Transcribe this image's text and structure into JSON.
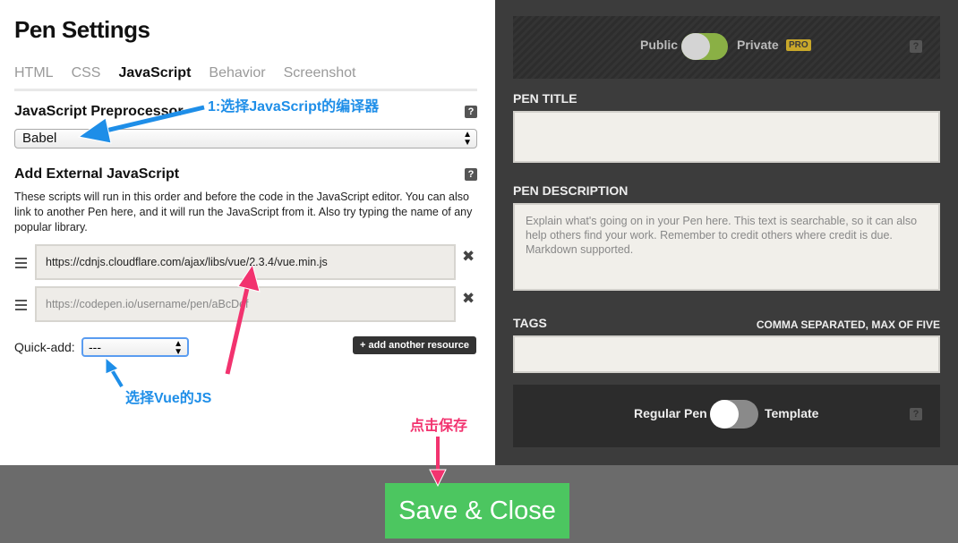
{
  "settings": {
    "title": "Pen Settings",
    "tabs": [
      {
        "label": "HTML"
      },
      {
        "label": "CSS"
      },
      {
        "label": "JavaScript"
      },
      {
        "label": "Behavior"
      },
      {
        "label": "Screenshot"
      }
    ],
    "active_tab": "JavaScript",
    "preprocessor": {
      "label": "JavaScript Preprocessor",
      "value": "Babel",
      "help": "?"
    },
    "external": {
      "label": "Add External JavaScript",
      "help": "?",
      "description": "These scripts will run in this order and before the code in the JavaScript editor. You can also link to another Pen here, and it will run the JavaScript from it. Also try typing the name of any popular library.",
      "resources": [
        {
          "value": "https://cdnjs.cloudflare.com/ajax/libs/vue/2.3.4/vue.min.js",
          "placeholder": ""
        },
        {
          "value": "",
          "placeholder": "https://codepen.io/username/pen/aBcDef"
        }
      ],
      "remove_icon": "✖",
      "quick_add_label": "Quick-add:",
      "quick_add_value": "---",
      "add_resource_label": "+ add another resource"
    }
  },
  "details": {
    "visibility": {
      "public_label": "Public",
      "private_label": "Private",
      "pro_badge": "PRO",
      "help": "?"
    },
    "title_label": "PEN TITLE",
    "title_value": "",
    "description_label": "PEN DESCRIPTION",
    "description_placeholder": "Explain what's going on in your Pen here. This text is searchable, so it can also help others find your work. Remember to credit others where credit is due. Markdown supported.",
    "tags_label": "TAGS",
    "tags_hint": "COMMA SEPARATED, MAX OF FIVE",
    "tags_value": "",
    "template": {
      "regular_label": "Regular Pen",
      "template_label": "Template",
      "help": "?"
    }
  },
  "footer": {
    "save_label": "Save & Close"
  },
  "annotations": {
    "step1": "1:选择JavaScript的编译器",
    "choose_vue": "选择Vue的JS",
    "click_save": "点击保存"
  },
  "colors": {
    "accent_blue": "#1e8ee8",
    "accent_pink": "#f2336f",
    "save_green": "#4cc660",
    "toggle_green": "#8ab045",
    "pro_gold": "#c9a82a"
  }
}
